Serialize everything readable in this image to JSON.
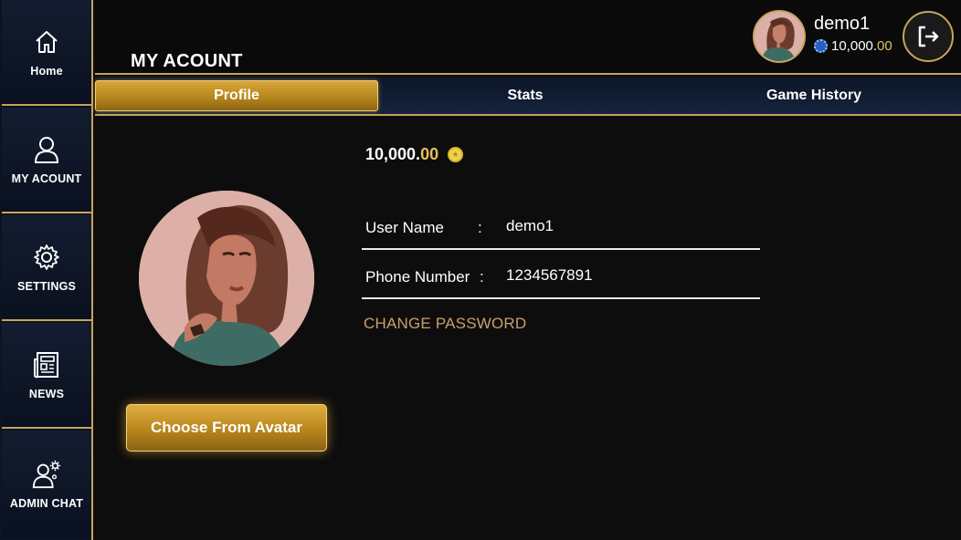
{
  "sidebar": {
    "items": [
      {
        "label": "Home",
        "icon": "home-icon"
      },
      {
        "label": "MY ACOUNT",
        "icon": "user-icon"
      },
      {
        "label": "SETTINGS",
        "icon": "gear-icon"
      },
      {
        "label": "NEWS",
        "icon": "newspaper-icon"
      },
      {
        "label": "ADMIN CHAT",
        "icon": "admin-user-gear-icon"
      }
    ]
  },
  "header": {
    "title": "MY ACOUNT",
    "username": "demo1",
    "balance_int": "10,000.",
    "balance_dec": "00"
  },
  "tabs": [
    {
      "label": "Profile",
      "active": true
    },
    {
      "label": "Stats",
      "active": false
    },
    {
      "label": "Game History",
      "active": false
    }
  ],
  "profile": {
    "balance_int": "10,000.",
    "balance_dec": "00",
    "choose_avatar_label": "Choose From Avatar",
    "fields": [
      {
        "label": "User Name",
        "separator": ":",
        "value": "demo1"
      },
      {
        "label": "Phone Number",
        "separator": ":",
        "value": "1234567891"
      }
    ],
    "change_password_label": "CHANGE PASSWORD"
  },
  "colors": {
    "gold_accent": "#c9a35b",
    "gold_button": "#b9861c",
    "decimal_yellow": "#e5c15c",
    "link_tan": "#c9a06c",
    "navy": "#0c1527"
  }
}
